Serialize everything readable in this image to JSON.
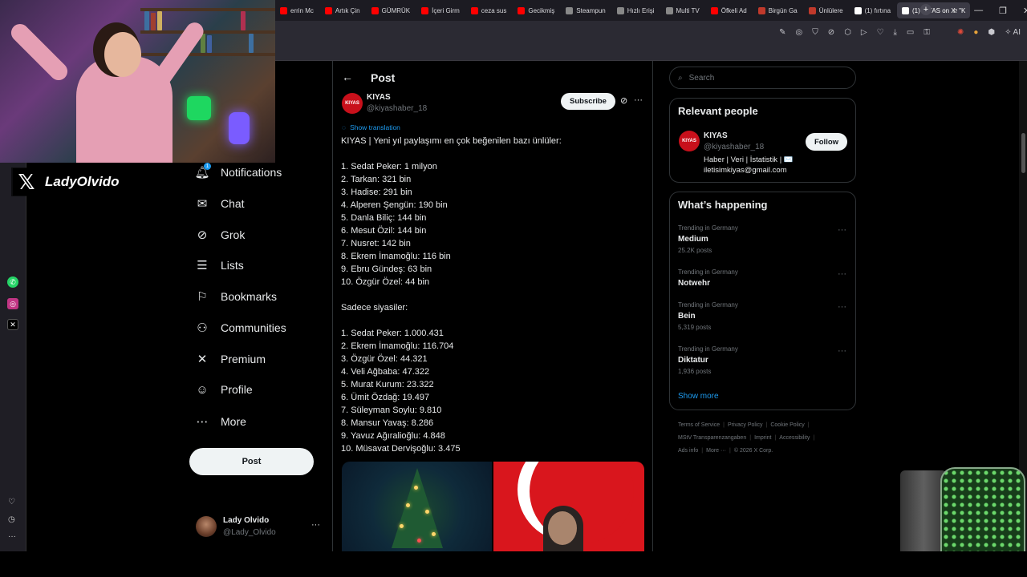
{
  "browser": {
    "tabs": [
      {
        "label": "errin Mc",
        "color": "#ff0000"
      },
      {
        "label": "Artık Çin",
        "color": "#ff0000"
      },
      {
        "label": "GÜMRÜK",
        "color": "#ff0000"
      },
      {
        "label": "İçeri Girm",
        "color": "#ff0000"
      },
      {
        "label": "ceza sus",
        "color": "#ff0000"
      },
      {
        "label": "Gecikmiş",
        "color": "#ff0000"
      },
      {
        "label": "Steampun",
        "color": "#888888"
      },
      {
        "label": "Hızlı Erişi",
        "color": "#888888"
      },
      {
        "label": "Multi TV",
        "color": "#888888"
      },
      {
        "label": "Öfkeli Ad",
        "color": "#ff0000"
      },
      {
        "label": "Birgün Ga",
        "color": "#c0392b"
      },
      {
        "label": "Ünlülere",
        "color": "#c0392b"
      },
      {
        "label": "(1) fırtına",
        "color": "#ffffff"
      },
      {
        "label": "(1) KIYAS on X: \"K",
        "color": "#ffffff",
        "active": true
      }
    ],
    "new_tab": "+",
    "ai_label": "AI"
  },
  "webcam": {
    "overlay_name": "LadyOlvido"
  },
  "nav": {
    "notifications_badge": "1",
    "items": [
      {
        "label": "Notifications",
        "icon": "bell-icon"
      },
      {
        "label": "Chat",
        "icon": "mail-icon"
      },
      {
        "label": "Grok",
        "icon": "grok-icon"
      },
      {
        "label": "Lists",
        "icon": "list-icon"
      },
      {
        "label": "Bookmarks",
        "icon": "bookmark-icon"
      },
      {
        "label": "Communities",
        "icon": "communities-icon"
      },
      {
        "label": "Premium",
        "icon": "x-logo-icon"
      },
      {
        "label": "Profile",
        "icon": "profile-icon"
      },
      {
        "label": "More",
        "icon": "more-icon"
      }
    ],
    "post_button": "Post",
    "account": {
      "name": "Lady Olvido",
      "handle": "@Lady_Olvido",
      "more": "···"
    }
  },
  "post": {
    "header_title": "Post",
    "author_avatar": "KIYAS",
    "author_name": "KIYAS",
    "author_handle": "@kiyashaber_18",
    "subscribe_label": "Subscribe",
    "show_translation": "Show translation",
    "lines": [
      "KIYAS | Yeni yıl paylaşımı en çok beğenilen bazı ünlüler:",
      "",
      "1. Sedat Peker: 1 milyon",
      "2. Tarkan: 321 bin",
      "3. Hadise: 291 bin",
      "4. Alperen Şengün: 190 bin",
      "5. Danla Biliç: 144 bin",
      "6. Mesut Özil: 144 bin",
      "7. Nusret: 142 bin",
      "8. Ekrem İmamoğlu: 116 bin",
      "9. Ebru Gündeş: 63 bin",
      "10. Özgür Özel: 44 bin",
      "",
      "Sadece siyasiler:",
      "",
      "1. Sedat Peker: 1.000.431",
      "2. Ekrem İmamoğlu: 116.704",
      "3. Özgür Özel: 44.321",
      "4. Veli Ağbaba: 47.322",
      "5. Murat Kurum: 23.322",
      "6. Ümit Özdağ: 19.497",
      "7. Süleyman Soylu: 9.810",
      "8. Mansur Yavaş: 8.286",
      "9. Yavuz Ağıralioğlu: 4.848",
      "10. Müsavat Dervişoğlu: 3.475"
    ]
  },
  "right": {
    "search_placeholder": "Search",
    "relevant_title": "Relevant people",
    "relevant": {
      "avatar": "KIYAS",
      "name": "KIYAS",
      "handle": "@kiyashaber_18",
      "bio": "Haber | Veri | İstatistik | ✉️ iletisimkiyas@gmail.com",
      "follow_label": "Follow"
    },
    "happening_title": "What’s happening",
    "trends": [
      {
        "meta": "Trending in Germany",
        "name": "Medium",
        "count": "25.2K posts"
      },
      {
        "meta": "Trending in Germany",
        "name": "Notwehr",
        "count": ""
      },
      {
        "meta": "Trending in Germany",
        "name": "Bein",
        "count": "5,319 posts"
      },
      {
        "meta": "Trending in Germany",
        "name": "Diktatur",
        "count": "1,936 posts"
      }
    ],
    "show_more": "Show more",
    "footer": [
      [
        "Terms of Service",
        "Privacy Policy",
        "Cookie Policy"
      ],
      [
        "MStV Transparenzangaben",
        "Imprint",
        "Accessibility"
      ],
      [
        "Ads info",
        "More ···",
        "© 2026 X Corp."
      ]
    ]
  }
}
